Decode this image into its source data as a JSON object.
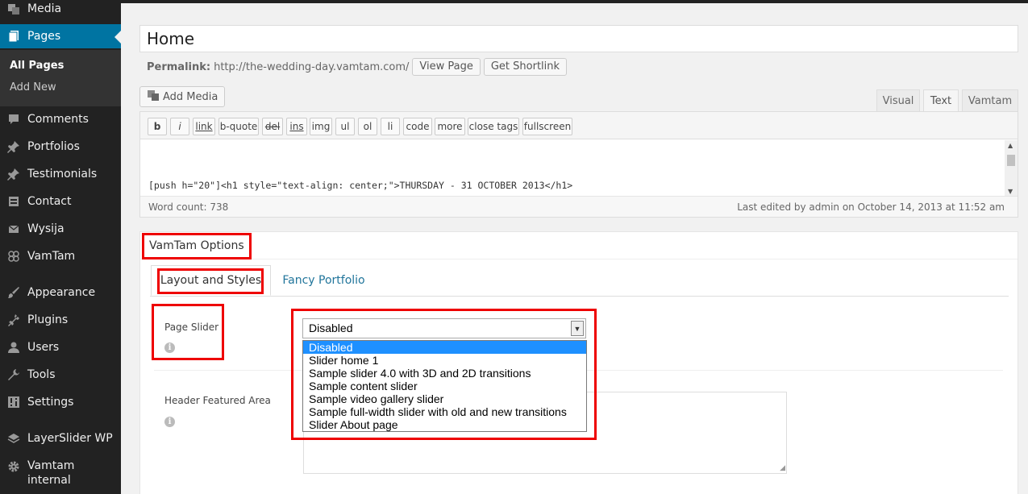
{
  "sidebar": {
    "items": [
      {
        "label": "Media",
        "icon": "media-icon"
      },
      {
        "label": "Pages",
        "icon": "pages-icon"
      },
      {
        "label": "Comments",
        "icon": "comments-icon"
      },
      {
        "label": "Portfolios",
        "icon": "pin-icon"
      },
      {
        "label": "Testimonials",
        "icon": "pin-icon"
      },
      {
        "label": "Contact",
        "icon": "contact-icon"
      },
      {
        "label": "Wysija",
        "icon": "mail-icon"
      },
      {
        "label": "VamTam",
        "icon": "vamtam-icon"
      },
      {
        "label": "Appearance",
        "icon": "brush-icon"
      },
      {
        "label": "Plugins",
        "icon": "plug-icon"
      },
      {
        "label": "Users",
        "icon": "user-icon"
      },
      {
        "label": "Tools",
        "icon": "wrench-icon"
      },
      {
        "label": "Settings",
        "icon": "settings-icon"
      },
      {
        "label": "LayerSlider WP",
        "icon": "layers-icon"
      },
      {
        "label": "Vamtam internal",
        "icon": "gear-icon"
      }
    ],
    "submenu": {
      "all_pages": "All Pages",
      "add_new": "Add New"
    }
  },
  "post": {
    "title": "Home",
    "permalink_label": "Permalink:",
    "permalink_url": "http://the-wedding-day.vamtam.com/",
    "view_page": "View Page",
    "get_shortlink": "Get Shortlink"
  },
  "editor": {
    "add_media": "Add Media",
    "tabs": [
      "Visual",
      "Text",
      "Vamtam"
    ],
    "active_tab": "Text",
    "quicktags": [
      "b",
      "i",
      "link",
      "b-quote",
      "del",
      "ins",
      "img",
      "ul",
      "ol",
      "li",
      "code",
      "more",
      "close tags",
      "fullscreen"
    ],
    "content_line": "[push h=\"20\"]<h1 style=\"text-align: center;\">THURSDAY - 31 OCTOBER 2013</h1>",
    "word_count": "Word count: 738",
    "last_edited": "Last edited by admin on October 14, 2013 at 11:52 am"
  },
  "options": {
    "title": "VamTam Options",
    "tabs": [
      "Layout and Styles",
      "Fancy Portfolio"
    ],
    "page_slider_label": "Page Slider",
    "header_featured_label": "Header Featured Area",
    "slider": {
      "selected": "Disabled",
      "options": [
        "Disabled",
        "Slider home 1",
        "Sample slider 4.0 with 3D and 2D transitions",
        "Sample content slider",
        "Sample video gallery slider",
        "Sample full-width slider with old and new transitions",
        "Slider About page"
      ]
    }
  },
  "colors": {
    "accent": "#0074a2",
    "highlight": "#ee0000",
    "selected_option": "#1e90ff"
  }
}
